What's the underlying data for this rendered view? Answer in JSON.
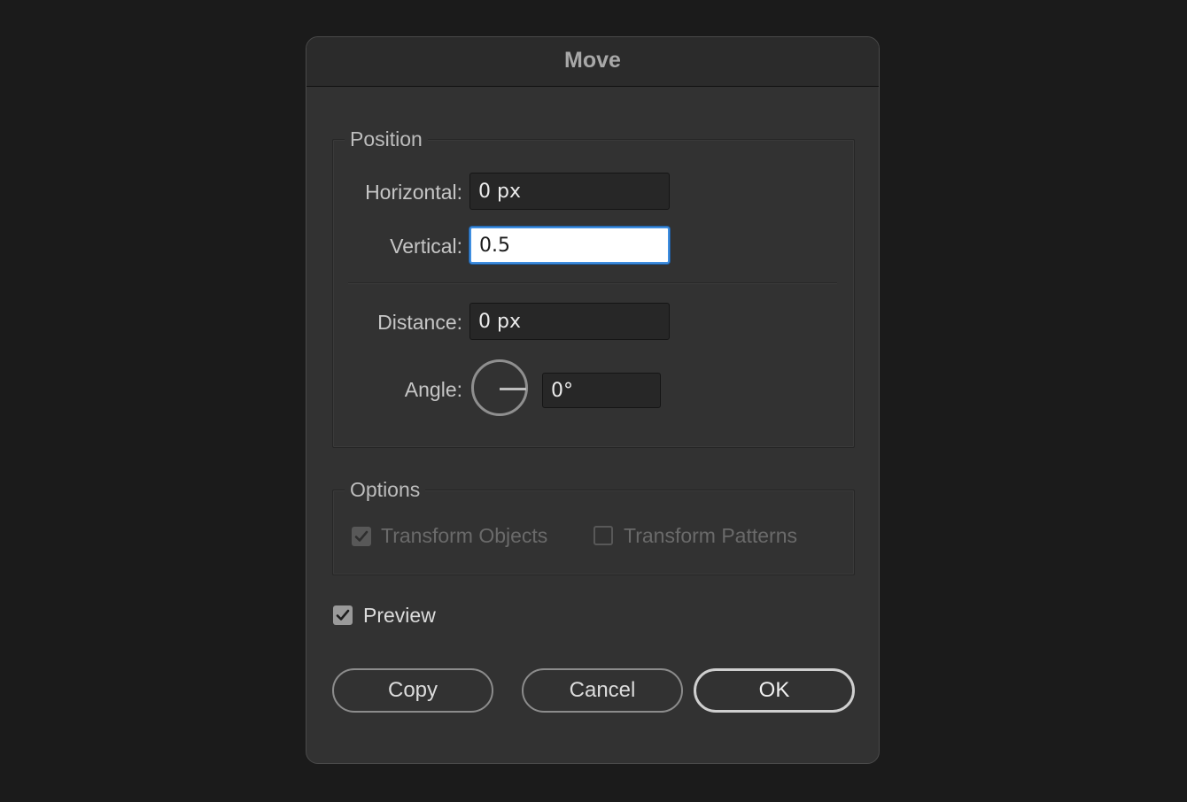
{
  "dialog": {
    "title": "Move"
  },
  "position": {
    "legend": "Position",
    "horizontal_label": "Horizontal:",
    "horizontal_value": "0 px",
    "vertical_label": "Vertical:",
    "vertical_value": "0.5",
    "distance_label": "Distance:",
    "distance_value": "0 px",
    "angle_label": "Angle:",
    "angle_value": "0°"
  },
  "options": {
    "legend": "Options",
    "transform_objects_label": "Transform Objects",
    "transform_objects_checked": true,
    "transform_patterns_label": "Transform Patterns",
    "transform_patterns_checked": false
  },
  "preview": {
    "label": "Preview",
    "checked": true
  },
  "buttons": {
    "copy": "Copy",
    "cancel": "Cancel",
    "ok": "OK"
  },
  "colors": {
    "background": "#1b1b1b",
    "dialog": "#323232",
    "focus_ring": "#3f8ee0"
  },
  "icons": {
    "angle_dial": "angle-dial-icon",
    "check": "checkmark-icon"
  }
}
